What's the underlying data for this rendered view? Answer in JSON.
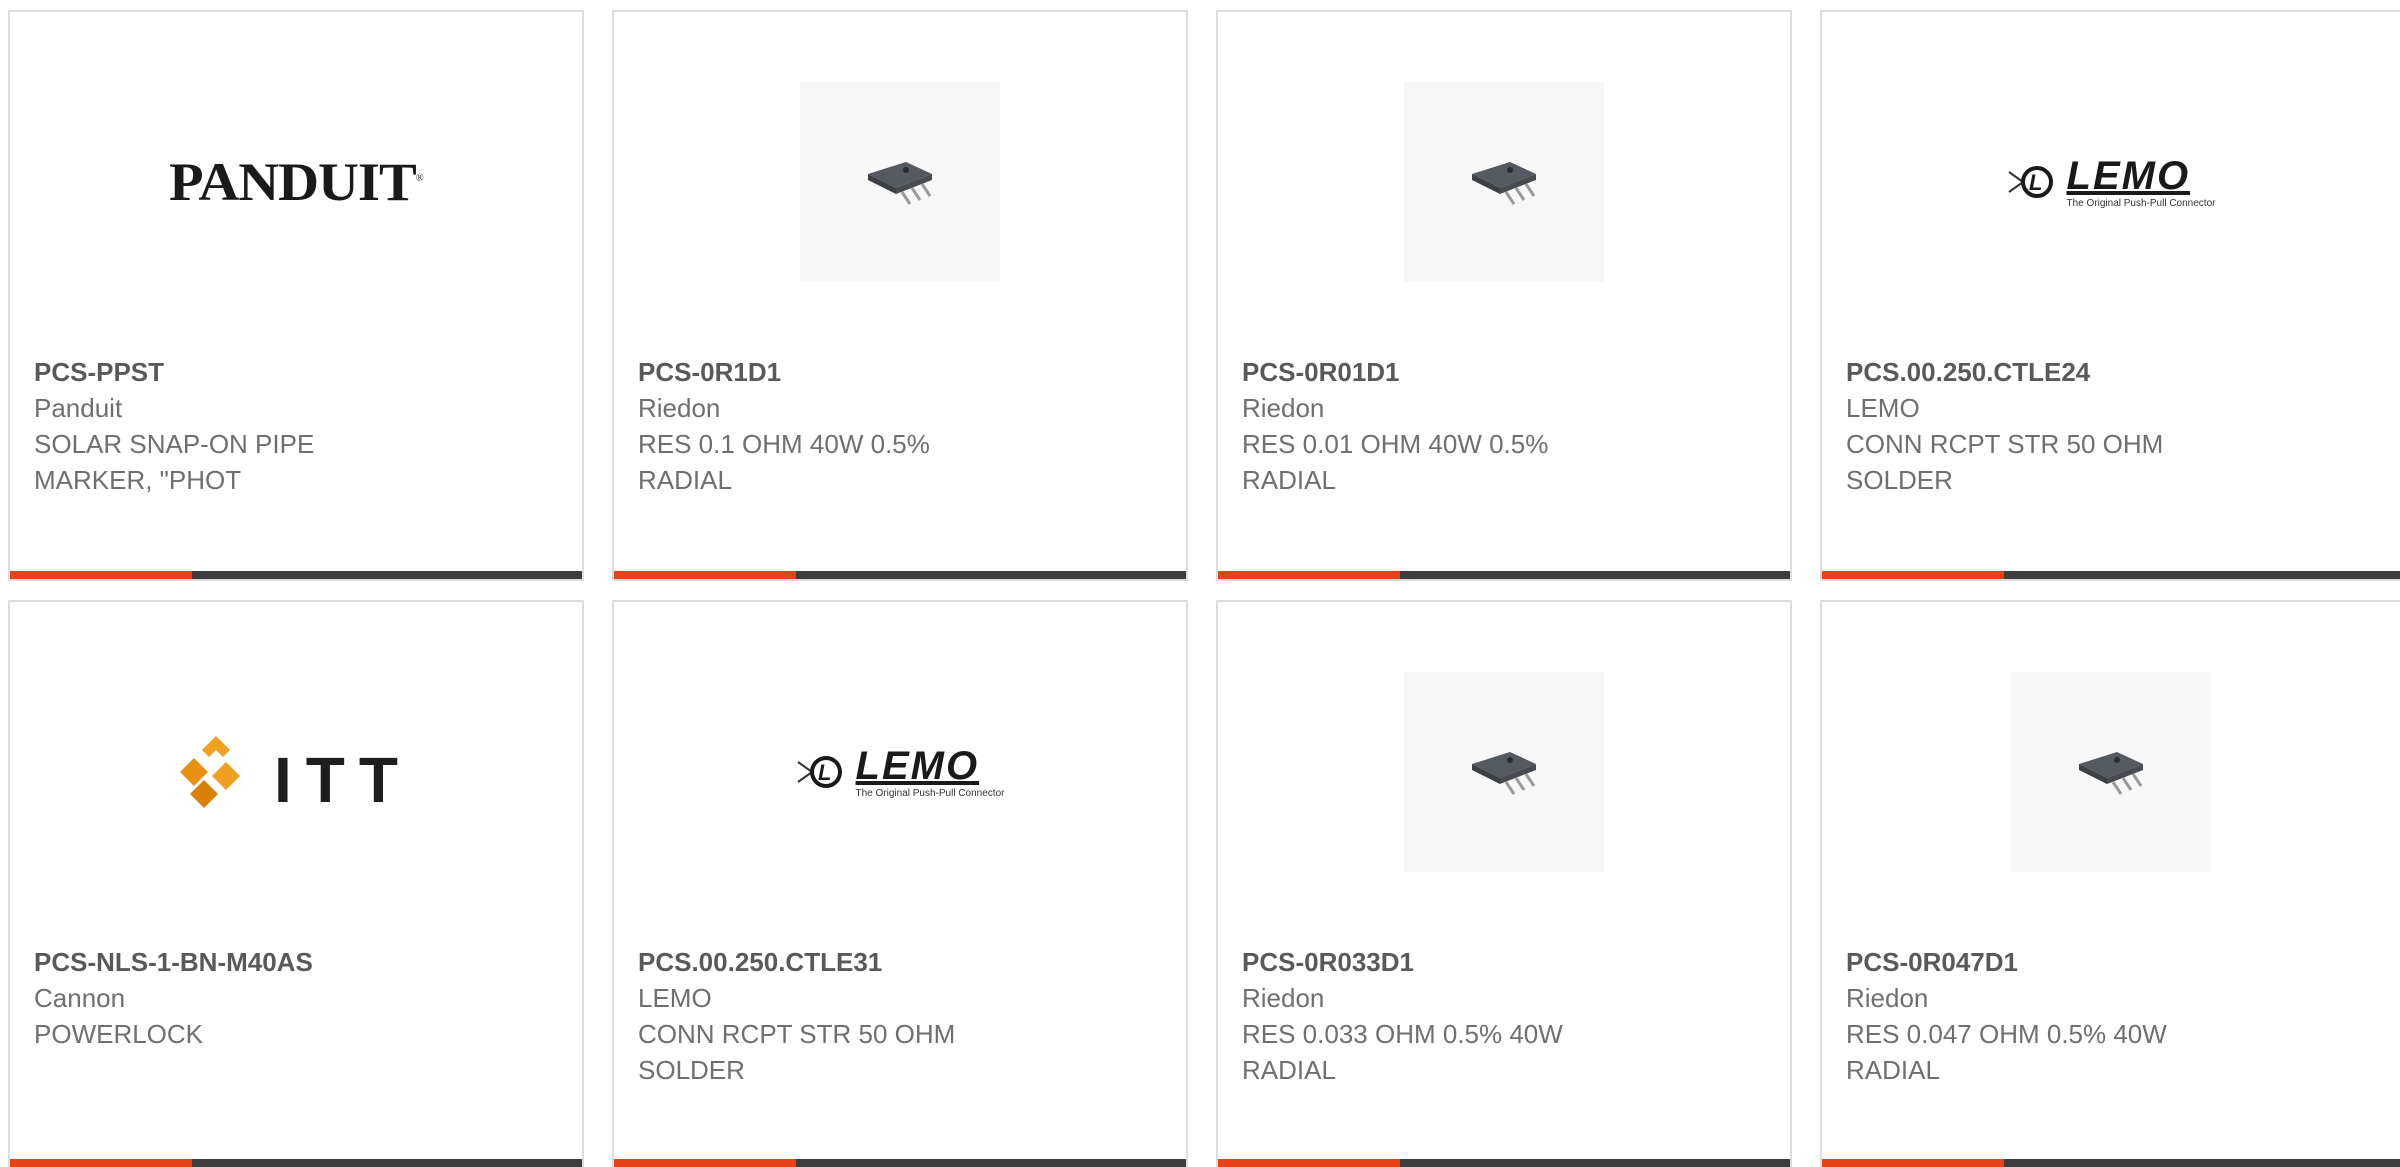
{
  "colors": {
    "accent": "#e8411a",
    "bar": "#3d3d3d",
    "border": "#dcdcdc",
    "title_text": "#595959",
    "body_text": "#6f6f6f"
  },
  "products": [
    {
      "image": "panduit-logo",
      "logo_text": "PANDUIT",
      "part_number": "PCS-PPST",
      "manufacturer": "Panduit",
      "description_lines": [
        "SOLAR SNAP-ON PIPE",
        "MARKER, \"PHOT"
      ]
    },
    {
      "image": "resistor-chip",
      "part_number": "PCS-0R1D1",
      "manufacturer": "Riedon",
      "description_lines": [
        "RES 0.1 OHM 40W 0.5%",
        "RADIAL"
      ]
    },
    {
      "image": "resistor-chip",
      "part_number": "PCS-0R01D1",
      "manufacturer": "Riedon",
      "description_lines": [
        "RES 0.01 OHM 40W 0.5%",
        "RADIAL"
      ]
    },
    {
      "image": "lemo-logo",
      "logo_text": "LEMO",
      "logo_tagline": "The Original Push-Pull Connector",
      "part_number": "PCS.00.250.CTLE24",
      "manufacturer": "LEMO",
      "description_lines": [
        "CONN RCPT STR 50 OHM",
        "SOLDER"
      ]
    },
    {
      "image": "itt-logo",
      "logo_text": "ITT",
      "part_number": "PCS-NLS-1-BN-M40AS",
      "manufacturer": "Cannon",
      "description_lines": [
        "POWERLOCK",
        ""
      ]
    },
    {
      "image": "lemo-logo",
      "logo_text": "LEMO",
      "logo_tagline": "The Original Push-Pull Connector",
      "part_number": "PCS.00.250.CTLE31",
      "manufacturer": "LEMO",
      "description_lines": [
        "CONN RCPT STR 50 OHM",
        "SOLDER"
      ]
    },
    {
      "image": "resistor-chip",
      "part_number": "PCS-0R033D1",
      "manufacturer": "Riedon",
      "description_lines": [
        "RES 0.033 OHM 0.5% 40W",
        "RADIAL"
      ]
    },
    {
      "image": "resistor-chip",
      "part_number": "PCS-0R047D1",
      "manufacturer": "Riedon",
      "description_lines": [
        "RES 0.047 OHM 0.5% 40W",
        "RADIAL"
      ]
    }
  ]
}
